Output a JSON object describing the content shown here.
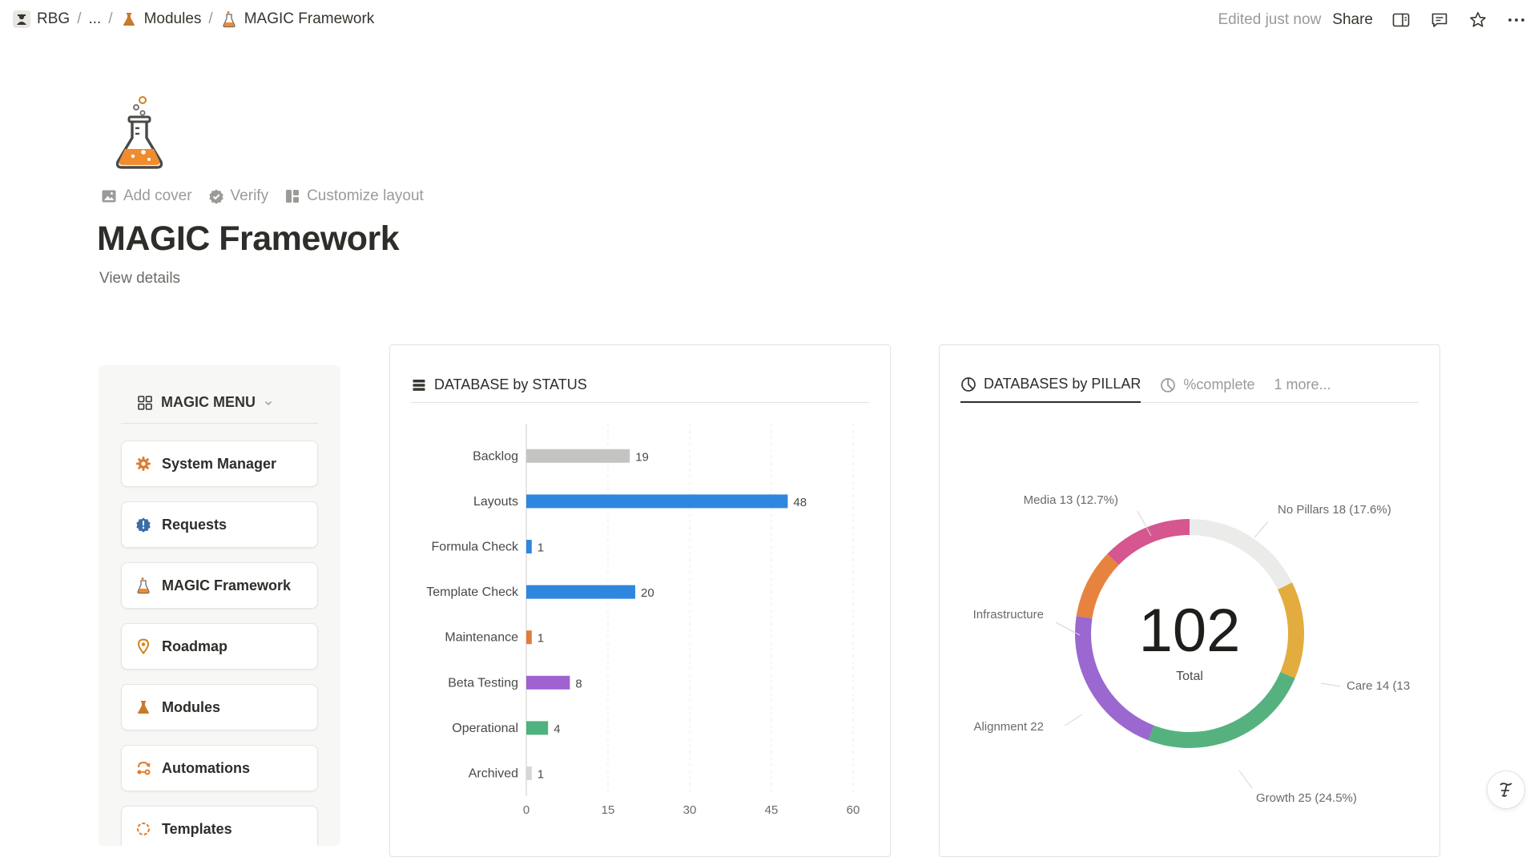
{
  "breadcrumb": {
    "workspace": "RBG",
    "ellipsis": "...",
    "parent": "Modules",
    "current": "MAGIC Framework",
    "separator": "/"
  },
  "topbar": {
    "edited": "Edited just now",
    "share": "Share"
  },
  "page": {
    "title": "MAGIC Framework",
    "view_details": "View details",
    "actions": {
      "add_cover": "Add cover",
      "verify": "Verify",
      "customize": "Customize layout"
    }
  },
  "menu": {
    "header": "MAGIC MENU",
    "items": [
      {
        "label": "System Manager",
        "icon": "gear-icon",
        "color": "#e07b2c"
      },
      {
        "label": "Requests",
        "icon": "alert-badge-icon",
        "color": "#3a6ea5"
      },
      {
        "label": "MAGIC Framework",
        "icon": "flask-icon",
        "color": "#e07b2c"
      },
      {
        "label": "Roadmap",
        "icon": "map-pin-icon",
        "color": "#d4821f"
      },
      {
        "label": "Modules",
        "icon": "beaker-icon",
        "color": "#c9792a"
      },
      {
        "label": "Automations",
        "icon": "automation-icon",
        "color": "#e07b2c"
      },
      {
        "label": "Templates",
        "icon": "template-icon",
        "color": "#e07b2c"
      }
    ]
  },
  "status_card": {
    "title": "DATABASE by STATUS"
  },
  "pillar_card": {
    "tabs": [
      "DATABASES by PILLAR",
      "%complete",
      "1 more..."
    ],
    "center_value": "102",
    "center_label": "Total"
  },
  "chart_data": [
    {
      "type": "bar",
      "orientation": "horizontal",
      "title": "DATABASE by STATUS",
      "categories": [
        "Backlog",
        "Layouts",
        "Formula Check",
        "Template Check",
        "Maintenance",
        "Beta Testing",
        "Operational",
        "Archived"
      ],
      "values": [
        19,
        48,
        1,
        20,
        1,
        8,
        4,
        1
      ],
      "colors": [
        "#c4c4c2",
        "#2f86de",
        "#2f86de",
        "#2f86de",
        "#e07b3c",
        "#a061d1",
        "#4fb27f",
        "#d6d6d4"
      ],
      "xlim": [
        0,
        60
      ],
      "xticks": [
        0,
        15,
        30,
        45,
        60
      ],
      "grid": true
    },
    {
      "type": "pie",
      "variant": "donut",
      "title": "DATABASES by PILLAR",
      "slices": [
        {
          "label": "No Pillars",
          "value": 18,
          "text": "No Pillars  18 (17.6%)",
          "color": "#ebebea"
        },
        {
          "label": "Care",
          "value": 14,
          "text": "Care  14 (13",
          "color": "#e2ac3f"
        },
        {
          "label": "Growth",
          "value": 25,
          "text": "Growth  25 (24.5%)",
          "color": "#55b27f"
        },
        {
          "label": "Alignment",
          "value": 22,
          "text": "Alignment  22",
          "color": "#9b67d0"
        },
        {
          "label": "Infrastructure",
          "value": 10,
          "text": "Infrastructure",
          "color": "#e6843f"
        },
        {
          "label": "Media",
          "value": 13,
          "text": "Media  13 (12.7%)",
          "color": "#d6568f"
        }
      ],
      "total": 102
    }
  ]
}
